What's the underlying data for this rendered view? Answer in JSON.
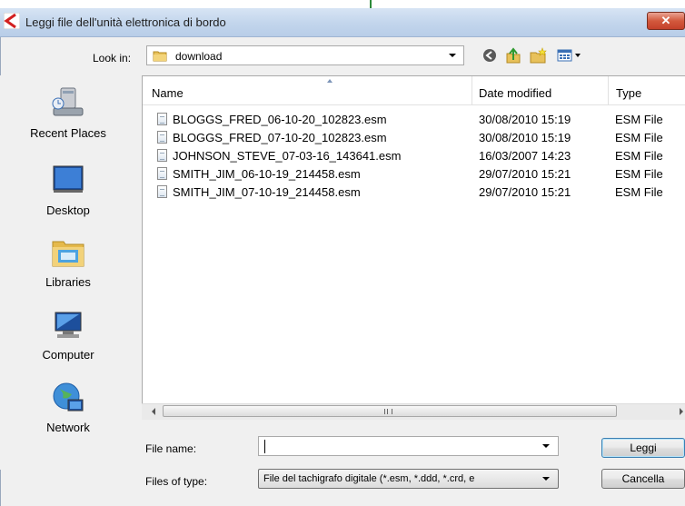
{
  "window": {
    "title": "Leggi file dell'unità elettronica di bordo",
    "close_label": "✕"
  },
  "lookin": {
    "label": "Look in:",
    "value": "download"
  },
  "toolbar": {
    "icons": [
      "back-icon",
      "up-folder-icon",
      "new-folder-icon",
      "view-menu-icon"
    ]
  },
  "places": [
    {
      "label": "Recent Places",
      "icon": "recent-places-icon"
    },
    {
      "label": "Desktop",
      "icon": "desktop-icon"
    },
    {
      "label": "Libraries",
      "icon": "libraries-icon"
    },
    {
      "label": "Computer",
      "icon": "computer-icon"
    },
    {
      "label": "Network",
      "icon": "network-icon"
    }
  ],
  "columns": {
    "name": "Name",
    "date": "Date modified",
    "type": "Type"
  },
  "files": [
    {
      "name": "BLOGGS_FRED_06-10-20_102823.esm",
      "date": "30/08/2010 15:19",
      "type": "ESM File"
    },
    {
      "name": "BLOGGS_FRED_07-10-20_102823.esm",
      "date": "30/08/2010 15:19",
      "type": "ESM File"
    },
    {
      "name": "JOHNSON_STEVE_07-03-16_143641.esm",
      "date": "16/03/2007 14:23",
      "type": "ESM File"
    },
    {
      "name": "SMITH_JIM_06-10-19_214458.esm",
      "date": "29/07/2010 15:21",
      "type": "ESM File"
    },
    {
      "name": "SMITH_JIM_07-10-19_214458.esm",
      "date": "29/07/2010 15:21",
      "type": "ESM File"
    }
  ],
  "filename": {
    "label": "File name:",
    "value": ""
  },
  "filetype": {
    "label": "Files of type:",
    "value": "File del tachigrafo digitale (*.esm, *.ddd, *.crd, e"
  },
  "buttons": {
    "open": "Leggi",
    "cancel": "Cancella"
  },
  "colors": {
    "title_bar": "#c2d5ec",
    "close_button": "#d3593d",
    "background": "#f0f0f0"
  }
}
